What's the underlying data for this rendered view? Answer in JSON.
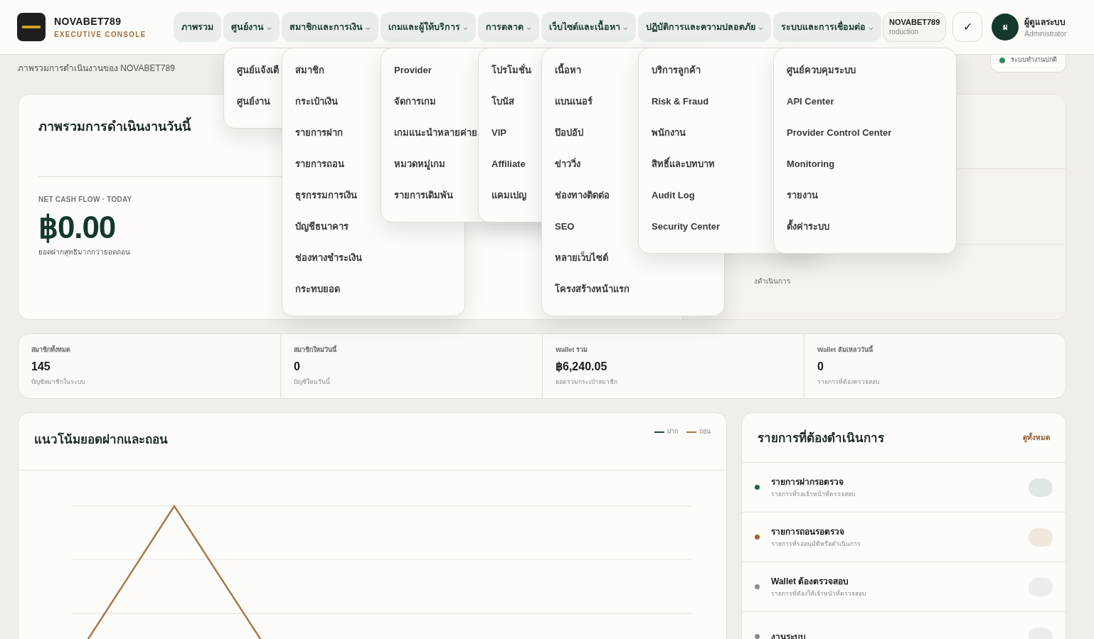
{
  "brand": {
    "name": "NOVABET789",
    "tagline": "EXECUTIVE CONSOLE"
  },
  "nav": [
    {
      "label": "ภาพรวม",
      "expanded": false
    },
    {
      "label": "ศูนย์งาน",
      "expanded": true,
      "menu": [
        "ศูนย์แจ้งเตื",
        "ศูนย์งาน"
      ]
    },
    {
      "label": "สมาชิกและการเงิน",
      "expanded": true,
      "menu": [
        "สมาชิก",
        "กระเป๋าเงิน",
        "รายการฝาก",
        "รายการถอน",
        "ธุรกรรมการเงิน",
        "บัญชีธนาคาร",
        "ช่องทางชำระเงิน",
        "กระทบยอด"
      ]
    },
    {
      "label": "เกมและผู้ให้บริการ",
      "expanded": true,
      "menu": [
        "Provider",
        "จัดการเกม",
        "เกมแนะนำหลายค่าย",
        "หมวดหมู่เกม",
        "รายการเดิมพัน"
      ]
    },
    {
      "label": "การตลาด",
      "expanded": true,
      "menu": [
        "โปรโมชั่น",
        "โบนัส",
        "VIP",
        "Affiliate",
        "แคมเปญ"
      ]
    },
    {
      "label": "เว็บไซต์และเนื้อหา",
      "expanded": true,
      "menu": [
        "เนื้อหา",
        "แบนเนอร์",
        "ป๊อปอัป",
        "ข่าววิ่ง",
        "ช่องทางติดต่อ",
        "SEO",
        "หลายเว็บไซต์",
        "โครงสร้างหน้าแรก"
      ]
    },
    {
      "label": "ปฏิบัติการและความปลอดภัย",
      "expanded": true,
      "menu": [
        "บริการลูกค้า",
        "Risk & Fraud",
        "พนักงาน",
        "สิทธิ์และบทบาท",
        "Audit Log",
        "Security Center"
      ]
    },
    {
      "label": "ระบบและการเชื่อมต่อ",
      "expanded": true,
      "menu": [
        "ศูนย์ควบคุมระบบ",
        "API Center",
        "Provider Control Center",
        "Monitoring",
        "รายงาน",
        "ตั้งค่าระบบ"
      ]
    }
  ],
  "environment": {
    "name": "NOVABET789",
    "label": "roduction"
  },
  "check_button": "✓",
  "user": {
    "initial": "ผ",
    "name": "ผู้ดูแลระบบ",
    "role": "Administrator"
  },
  "page": {
    "subtitle": "ภาพรวมการดำเนินงานของ NOVABET789",
    "status": "ระบบทำงานปกติ"
  },
  "overview": {
    "title": "ภาพรวมการดำเนินงานวันนี้",
    "kicker": "NET CASH FLOW · TODAY",
    "value": "฿0.00",
    "note": "ยอดฝากสุทธิมากกว่ายอดถอน",
    "side_text": "งดำเนินการ"
  },
  "stats": [
    {
      "label": "สมาชิกทั้งหมด",
      "value": "145",
      "note": "บัญชีสมาชิกในระบบ"
    },
    {
      "label": "สมาชิกใหม่วันนี้",
      "value": "0",
      "note": "บัญชีใหม่วันนี้"
    },
    {
      "label": "Wallet รวม",
      "value": "฿6,240.05",
      "note": "ยอดรวมกระเป๋าสมาชิก"
    },
    {
      "label": "Wallet ล้มเหลววันนี้",
      "value": "0",
      "note": "รายการที่ต้องตรวจสอบ"
    }
  ],
  "trend": {
    "title": "แนวโน้มยอดฝากและถอน",
    "legend": [
      {
        "name": "ฝาก",
        "color": "#1f4d3a"
      },
      {
        "name": "ถอน",
        "color": "#a8784a"
      }
    ]
  },
  "actions": {
    "title": "รายการที่ต้องดำเนินการ",
    "link": "ดูทั้งหมด",
    "items": [
      {
        "title": "รายการฝากรอตรวจ",
        "note": "รายการที่รอเจ้าหน้าที่ตรวจสอบ",
        "color": "#1f6b4a"
      },
      {
        "title": "รายการถอนรอตรวจ",
        "note": "รายการที่รออนุมัติหรือดำเนินการ",
        "color": "#a0652a"
      },
      {
        "title": "Wallet ต้องตรวจสอบ",
        "note": "รายการที่ต้องให้เจ้าหน้าที่ตรวจสอบ",
        "color": "#8c8c8c"
      },
      {
        "title": "งานระบบ",
        "color": "#8c8c8c"
      }
    ]
  }
}
